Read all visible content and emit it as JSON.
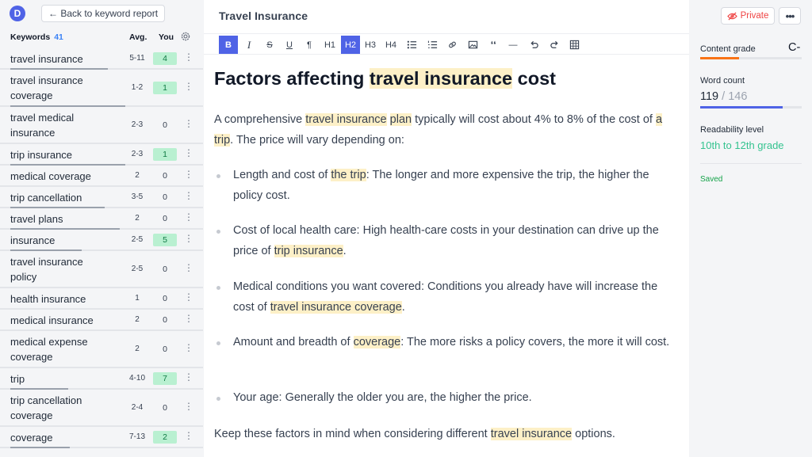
{
  "sidebar": {
    "logo_letter": "D",
    "back_label": "← Back to keyword report",
    "header": {
      "title": "Keywords",
      "count": "41",
      "avg": "Avg.",
      "you": "You"
    },
    "keywords": [
      {
        "name": "travel insurance",
        "avg": "5-11",
        "you": "4",
        "on": true,
        "progress": 0.85
      },
      {
        "name": "travel insurance coverage",
        "avg": "1-2",
        "you": "1",
        "on": true,
        "progress": 1.0
      },
      {
        "name": "travel medical insurance",
        "avg": "2-3",
        "you": "0",
        "on": false,
        "progress": 0.0
      },
      {
        "name": "trip insurance",
        "avg": "2-3",
        "you": "1",
        "on": true,
        "progress": 1.0
      },
      {
        "name": "medical coverage",
        "avg": "2",
        "you": "0",
        "on": false,
        "progress": 0.0
      },
      {
        "name": "trip cancellation",
        "avg": "3-5",
        "you": "0",
        "on": false,
        "progress": 0.82
      },
      {
        "name": "travel plans",
        "avg": "2",
        "you": "0",
        "on": false,
        "progress": 0.95
      },
      {
        "name": "insurance",
        "avg": "2-5",
        "you": "5",
        "on": true,
        "progress": 0.62
      },
      {
        "name": "travel insurance policy",
        "avg": "2-5",
        "you": "0",
        "on": false,
        "progress": 0.0
      },
      {
        "name": "health insurance",
        "avg": "1",
        "you": "0",
        "on": false,
        "progress": 0.0
      },
      {
        "name": "medical insurance",
        "avg": "2",
        "you": "0",
        "on": false,
        "progress": 0.0
      },
      {
        "name": "medical expense coverage",
        "avg": "2",
        "you": "0",
        "on": false,
        "progress": 0.0
      },
      {
        "name": "trip",
        "avg": "4-10",
        "you": "7",
        "on": true,
        "progress": 0.5
      },
      {
        "name": "trip cancellation coverage",
        "avg": "2-4",
        "you": "0",
        "on": false,
        "progress": 0.0
      },
      {
        "name": "coverage",
        "avg": "7-13",
        "you": "2",
        "on": true,
        "progress": 0.52
      }
    ]
  },
  "editor": {
    "title": "Travel Insurance",
    "toolbar": [
      {
        "name": "bold-button",
        "label": "B",
        "active": true
      },
      {
        "name": "italic-button",
        "label": "I",
        "active": false
      },
      {
        "name": "strikethrough-button",
        "label": "S",
        "active": false
      },
      {
        "name": "underline-button",
        "label": "U",
        "active": false
      },
      {
        "name": "paragraph-button",
        "label": "¶",
        "active": false
      },
      {
        "name": "h1-button",
        "label": "H1",
        "active": false
      },
      {
        "name": "h2-button",
        "label": "H2",
        "active": true
      },
      {
        "name": "h3-button",
        "label": "H3",
        "active": false
      },
      {
        "name": "h4-button",
        "label": "H4",
        "active": false
      },
      {
        "name": "bullet-list-button",
        "label": "",
        "active": false,
        "icon": "bullet-list-icon"
      },
      {
        "name": "numbered-list-button",
        "label": "",
        "active": false,
        "icon": "numbered-list-icon"
      },
      {
        "name": "link-button",
        "label": "",
        "active": false,
        "icon": "link-icon"
      },
      {
        "name": "image-button",
        "label": "",
        "active": false,
        "icon": "image-icon"
      },
      {
        "name": "quote-button",
        "label": "❛❛",
        "active": false
      },
      {
        "name": "divider-button",
        "label": "—",
        "active": false
      },
      {
        "name": "undo-button",
        "label": "",
        "active": false,
        "icon": "undo-icon"
      },
      {
        "name": "redo-button",
        "label": "",
        "active": false,
        "icon": "redo-icon"
      },
      {
        "name": "table-button",
        "label": "",
        "active": false,
        "icon": "table-icon"
      }
    ],
    "heading": {
      "pre": "Factors affecting ",
      "hl": "travel insurance",
      "post": " cost"
    },
    "intro": {
      "t1": "A comprehensive ",
      "h1": "travel insurance",
      "t2": " ",
      "h2": "plan",
      "t3": " typically will cost about 4% to 8% of the cost of ",
      "h3": "a trip",
      "t4": ". The price will vary depending on:"
    },
    "bullets": [
      {
        "pre": "Length and cost of ",
        "hl": "the trip",
        "post": ": The longer and more expensive the trip, the higher the policy cost."
      },
      {
        "pre": "Cost of local health care: High health-care costs in your destination can drive up the price of ",
        "hl": "trip insurance",
        "post": "."
      },
      {
        "pre": "Medical conditions you want covered: Conditions you already have will increase the cost of ",
        "hl": "travel insurance coverage",
        "post": "."
      },
      {
        "pre": "Amount and breadth of ",
        "hl": "coverage",
        "post": ": The more risks a policy covers, the more it will cost."
      },
      {
        "pre": "Your age: Generally the older you are, the higher the price.",
        "hl": "",
        "post": ""
      }
    ],
    "outro": {
      "pre": "Keep these factors in mind when considering different ",
      "hl": "travel insurance",
      "post": " options."
    }
  },
  "panel": {
    "private_label": "Private",
    "more_label": "•••",
    "content_grade_label": "Content grade",
    "content_grade": "C-",
    "content_grade_progress": 0.38,
    "word_count_label": "Word count",
    "word_count": "119",
    "word_target": " / 146",
    "word_progress": 0.815,
    "readability_label": "Readability level",
    "readability": "10th to 12th grade",
    "saved": "Saved"
  }
}
